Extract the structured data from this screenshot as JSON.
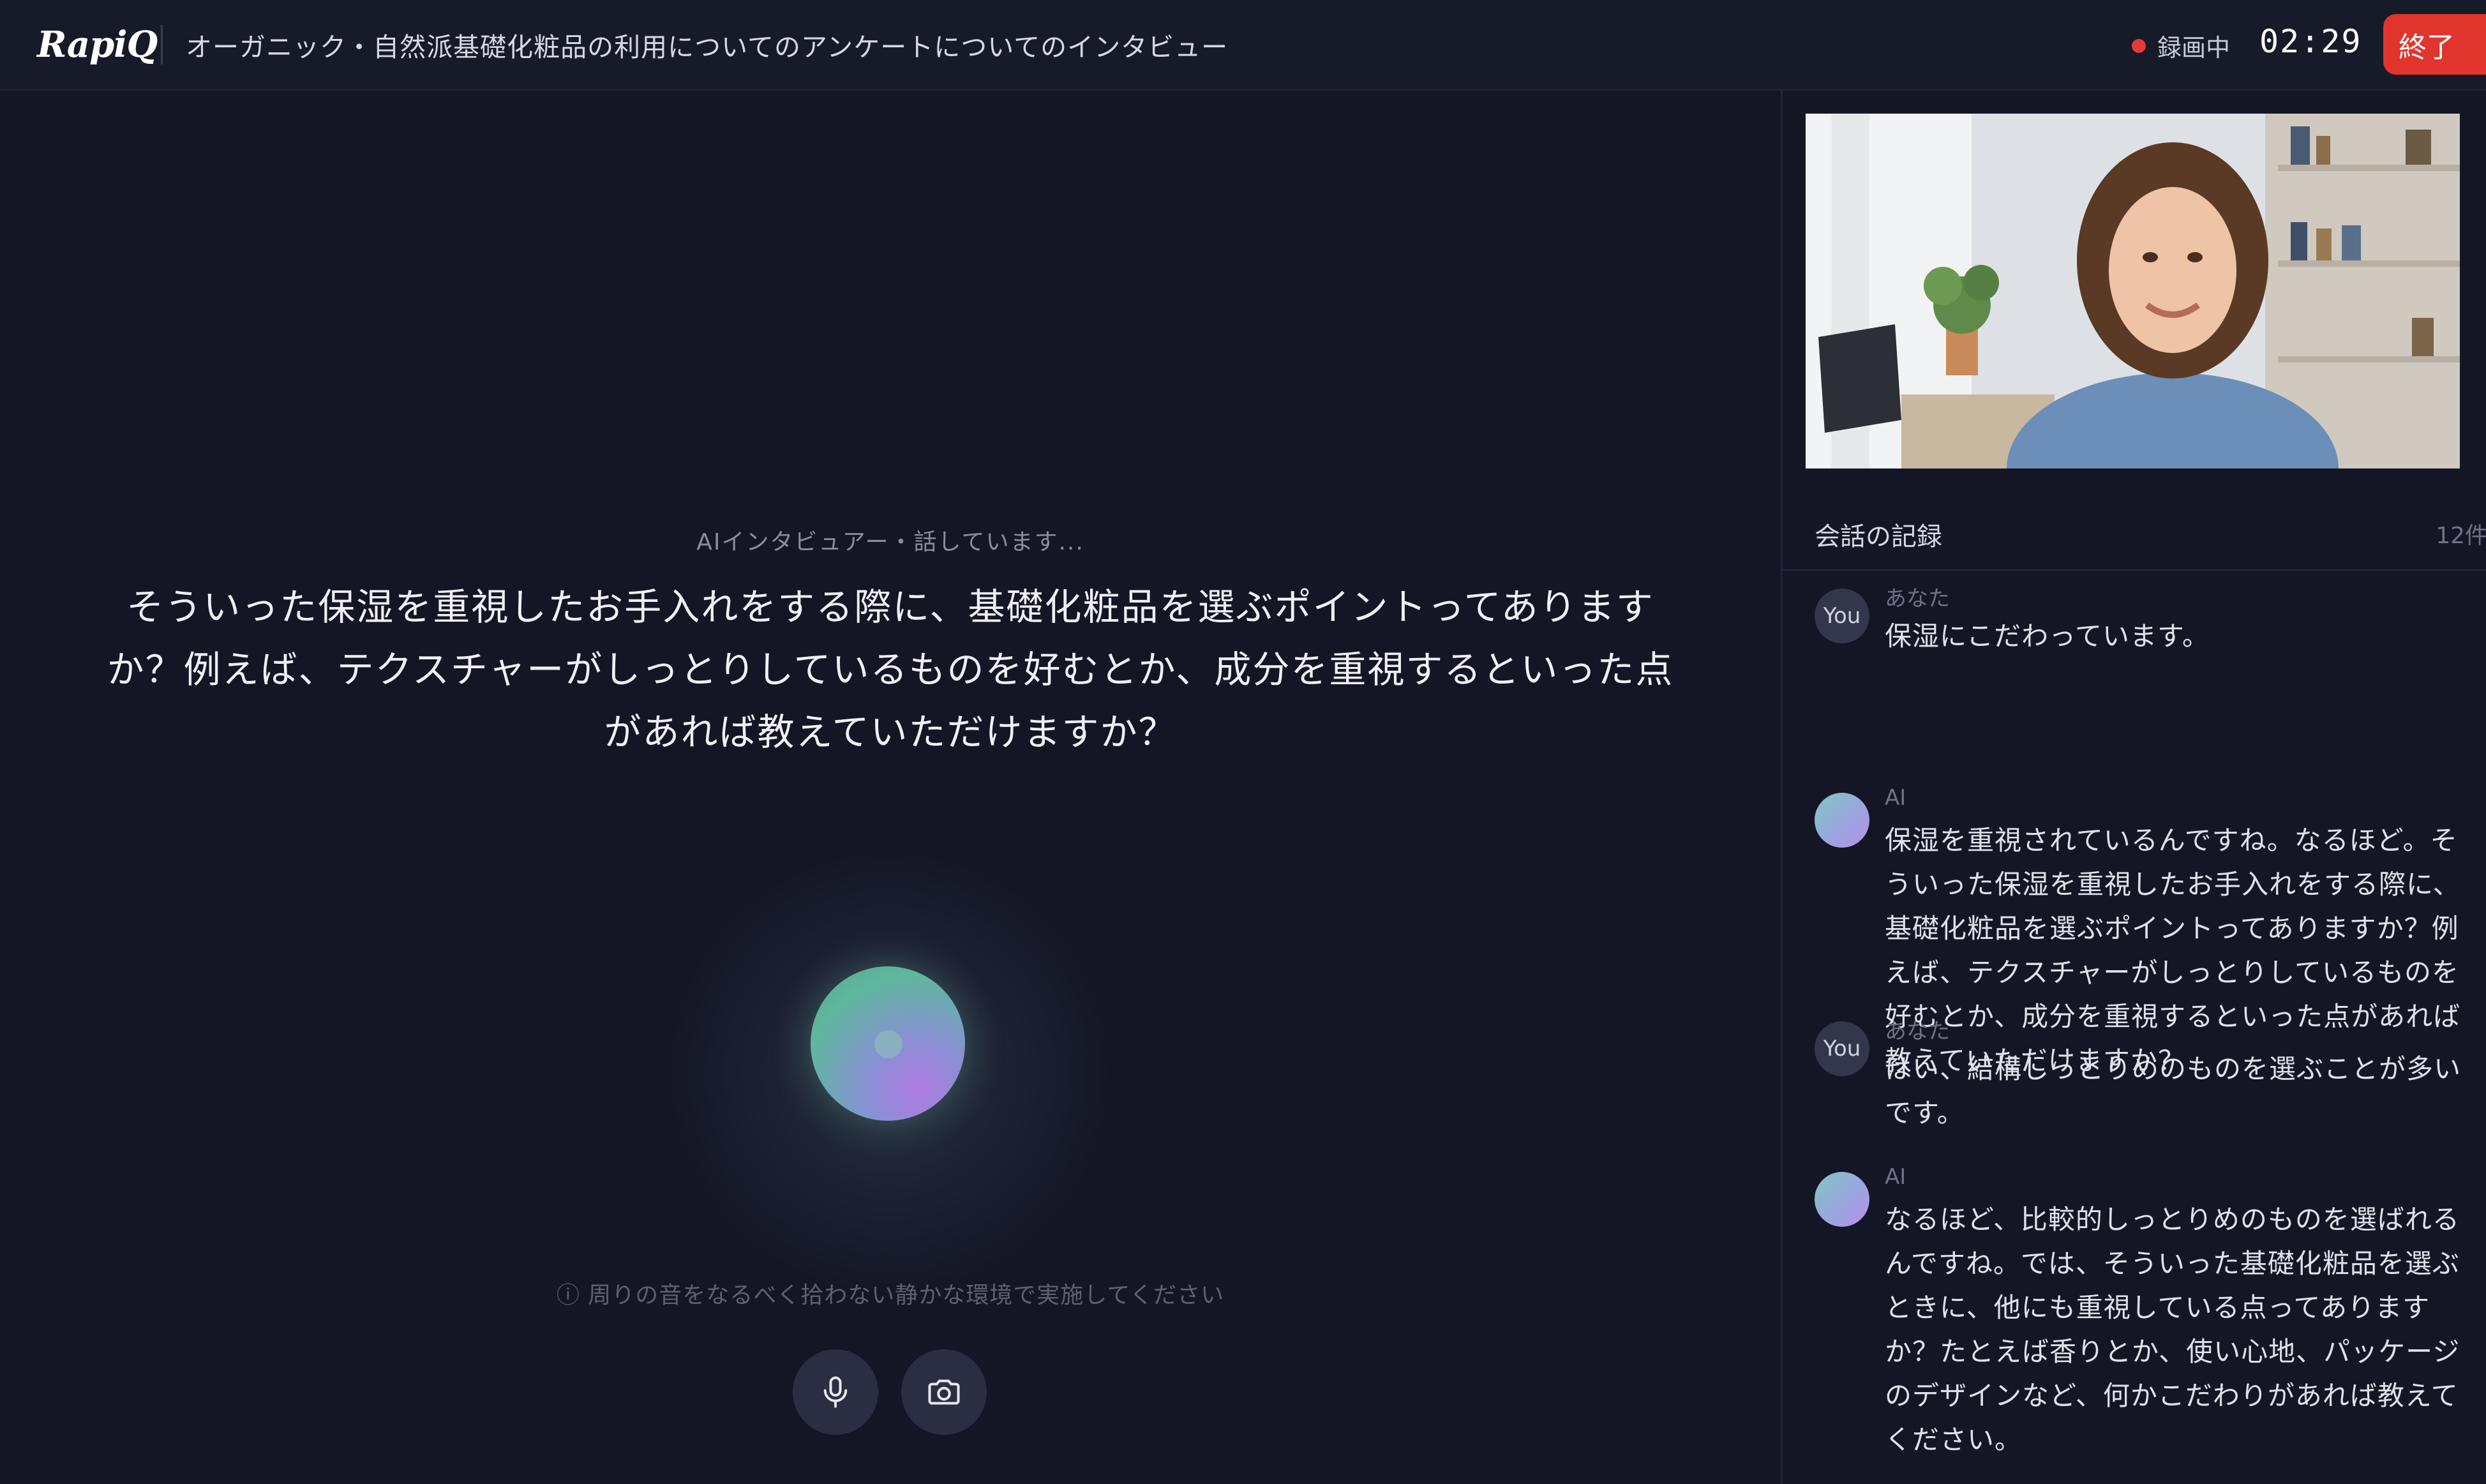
{
  "header": {
    "logo": "RapiQ",
    "title": "オーガニック・自然派基礎化粧品の利用についてのアンケートについてのインタビュー",
    "recording_label": "録画中",
    "timer": "02:29",
    "end_label": "終了"
  },
  "main": {
    "status": "AIインタビュアー・話しています...",
    "question": "そういった保湿を重視したお手入れをする際に、基礎化粧品を選ぶポイントってありますか？例えば、テクスチャーがしっとりしているものを好むとか、成分を重視するといった点があれば教えていただけますか？",
    "hint": "ⓘ 周りの音をなるべく拾わない静かな環境で実施してください"
  },
  "sidebar": {
    "log_title": "会話の記録",
    "log_count": "12件",
    "messages": [
      {
        "avatar": "You",
        "speaker": "あなた",
        "text": "保湿にこだわっています。"
      },
      {
        "avatar": "",
        "speaker": "AI",
        "text": "保湿を重視されているんですね。なるほど。そういった保湿を重視したお手入れをする際に、基礎化粧品を選ぶポイントってありますか？例えば、テクスチャーがしっとりしているものを好むとか、成分を重視するといった点があれば教えていただけますか？"
      },
      {
        "avatar": "You",
        "speaker": "あなた",
        "text": "はい、結構しっとりめのものを選ぶことが多いです。"
      },
      {
        "avatar": "",
        "speaker": "AI",
        "text": "なるほど、比較的しっとりめのものを選ばれるんですね。では、そういった基礎化粧品を選ぶときに、他にも重視している点ってありますか？たとえば香りとか、使い心地、パッケージのデザインなど、何かこだわりがあれば教えてください。"
      }
    ]
  },
  "colors": {
    "background": "#141625",
    "header": "#171a29",
    "end_button": "#e0352c",
    "recording_dot": "#e53935"
  }
}
